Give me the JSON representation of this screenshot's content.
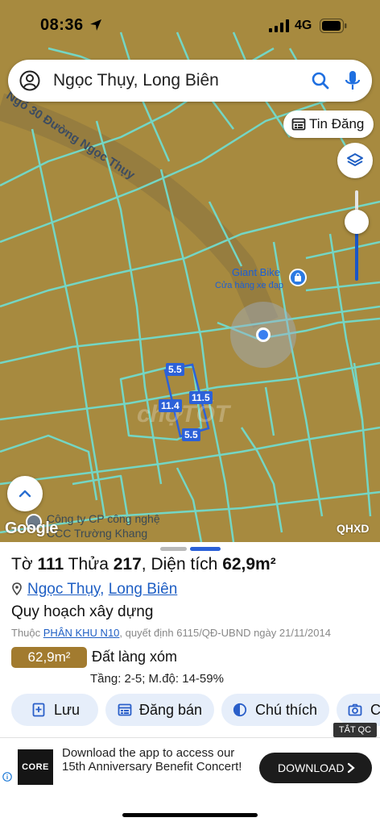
{
  "status_bar": {
    "time": "08:36",
    "network": "4G"
  },
  "search": {
    "query": "Ngọc Thụy, Long Biên"
  },
  "map": {
    "road_label": "Ngõ 30 Đường Ngọc Thụy",
    "tin_dang_label": "Tin Đăng",
    "poi": {
      "name": "Giant Bike",
      "subtitle": "Cửa hàng xe đạp"
    },
    "plot_dimensions": {
      "top": "5.5",
      "left": "11.4",
      "right": "11.5",
      "bottom": "5.5"
    },
    "watermark": "chợTỐT",
    "google_label": "Google",
    "company_label_line1": "Công ty CP công nghệ",
    "company_label_line2": "CCC Trường Khang",
    "layer_code": "QHXD",
    "colors": {
      "parcel_fill": "#a78a3f",
      "parcel_lines": "#74d6c4",
      "accent": "#2c61d8"
    }
  },
  "sheet": {
    "title_prefix": "Tờ",
    "sheet_no": "111",
    "title_mid": "Thửa",
    "plot_no": "217",
    "title_area_label": "Diện tích",
    "area": "62,9m²",
    "ward": "Ngọc Thụy",
    "separator": ",",
    "district": "Long Biên",
    "plan_heading": "Quy hoạch xây dựng",
    "plan_sub_prefix": "Thuộc",
    "plan_zone": "PHÂN KHU N10",
    "plan_sub_suffix": ", quyết định 6115/QĐ-UBND ngày 21/11/2014",
    "area_badge": "62,9m²",
    "land_type": "Đất làng xóm",
    "floors": "Tầng: 2-5; M.độ: 14-59%",
    "chips": [
      {
        "label": "Lưu",
        "icon": "bookmark-plus-icon"
      },
      {
        "label": "Đăng bán",
        "icon": "listing-icon"
      },
      {
        "label": "Chú thích",
        "icon": "legend-icon"
      },
      {
        "label": "C",
        "icon": "camera-icon"
      }
    ]
  },
  "ad": {
    "close_label": "TẮT QC",
    "logo_text": "CORE",
    "text": "Download the app to access our 15th Anniversary Benefit Concert!",
    "button_label": "DOWNLOAD"
  }
}
